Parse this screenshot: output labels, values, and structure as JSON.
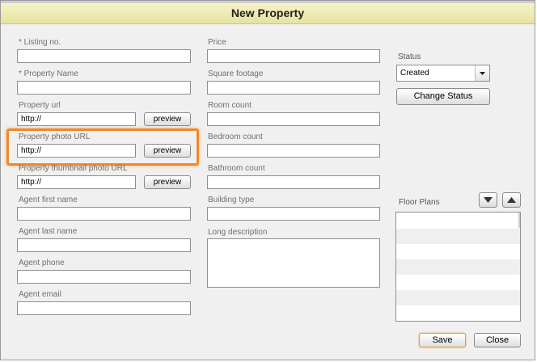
{
  "window": {
    "title": "New Property"
  },
  "left_fields": [
    {
      "label": "* Listing no.",
      "value": ""
    },
    {
      "label": "* Property Name",
      "value": ""
    },
    {
      "label": "Property url",
      "value": "http://",
      "button": "preview"
    },
    {
      "label": "Property photo URL",
      "value": "http://",
      "button": "preview"
    },
    {
      "label": "Property thumbnail photo URL",
      "value": "http://",
      "button": "preview"
    },
    {
      "label": "Agent first name",
      "value": ""
    },
    {
      "label": "Agent last name",
      "value": ""
    },
    {
      "label": "Agent phone",
      "value": ""
    },
    {
      "label": "Agent email",
      "value": ""
    }
  ],
  "middle_fields": [
    {
      "label": "Price",
      "value": ""
    },
    {
      "label": "Square footage",
      "value": ""
    },
    {
      "label": "Room count",
      "value": ""
    },
    {
      "label": "Bedroom count",
      "value": ""
    },
    {
      "label": "Bathroom count",
      "value": ""
    },
    {
      "label": "Building type",
      "value": ""
    },
    {
      "label": "Long description",
      "value": ""
    }
  ],
  "status": {
    "label": "Status",
    "selected": "Created",
    "change_button": "Change Status"
  },
  "floor_plans": {
    "label": "Floor Plans",
    "down_icon": "arrow-down-icon",
    "up_icon": "arrow-up-icon"
  },
  "footer": {
    "save": "Save",
    "close": "Close"
  },
  "colors": {
    "title_bar": "#eeeab4",
    "highlight": "#f0882a",
    "save_border": "#f0a040"
  }
}
